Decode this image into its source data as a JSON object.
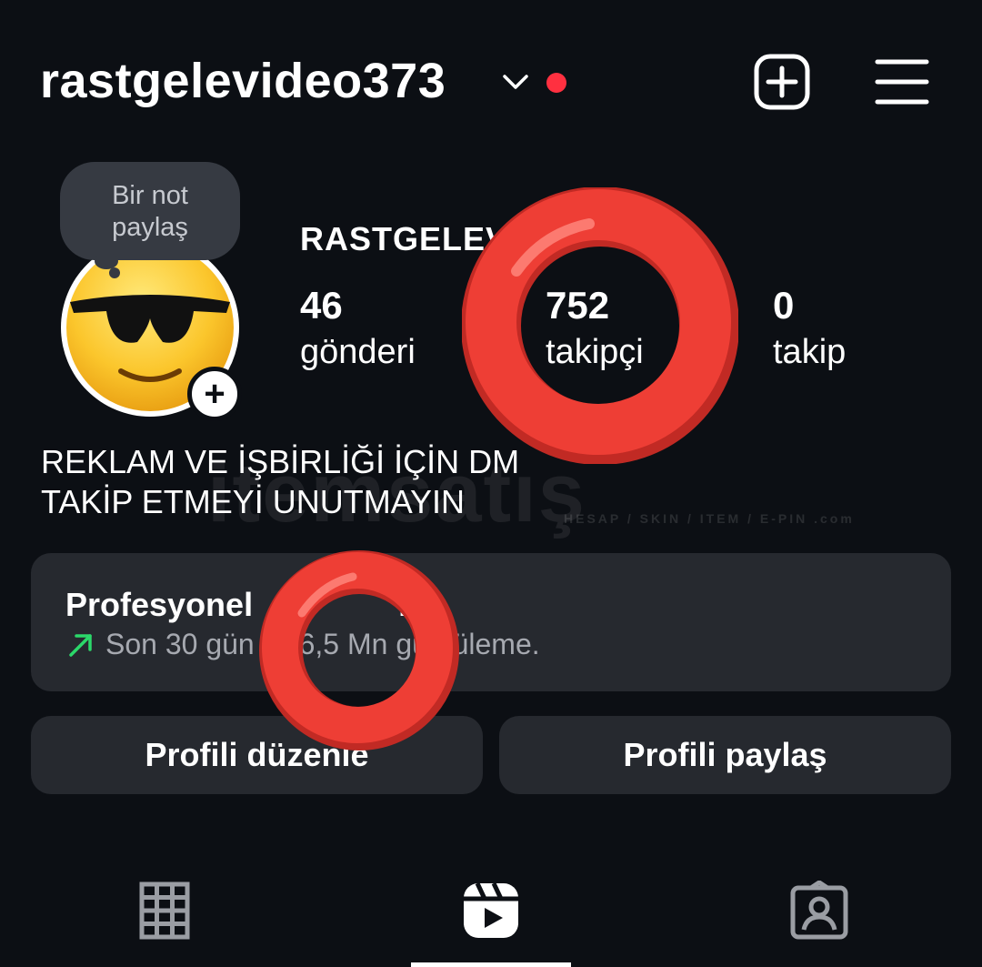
{
  "header": {
    "username": "rastgelevideo373",
    "has_notification": true
  },
  "note": {
    "line1": "Bir not",
    "line2": "paylaş"
  },
  "profile": {
    "display_name": "RASTGELEV",
    "stats": [
      {
        "count": "46",
        "label": "gönderi"
      },
      {
        "count": "752",
        "label": "takipçi"
      },
      {
        "count": "0",
        "label": "takip"
      }
    ],
    "bio": [
      "REKLAM VE İŞBİRLİĞİ İÇİN DM",
      "TAKİP ETMEYİ UNUTMAYIN"
    ]
  },
  "professional_panel": {
    "title": "Profesyonel ",
    "title_end": "no",
    "subtitle_part1": "Son 30 gün",
    "subtitle_part2": " 6,5 Mn g",
    "subtitle_part3": "üntüleme."
  },
  "buttons": {
    "edit_profile": "Profili düzenle",
    "share_profile": "Profili paylaş"
  },
  "watermark": {
    "text": "itemsatış",
    "subtext": "HESAP / SKIN / ITEM / E-PIN .com"
  },
  "tabs": [
    {
      "icon": "grid-icon",
      "active": false
    },
    {
      "icon": "reels-icon",
      "active": true
    },
    {
      "icon": "tagged-icon",
      "active": false
    }
  ],
  "colors": {
    "background": "#0c0f14",
    "panel": "#26292f",
    "notification_dot": "#ff3040",
    "overlay_ring": "#e83b33",
    "growth_arrow": "#2bd86a"
  }
}
